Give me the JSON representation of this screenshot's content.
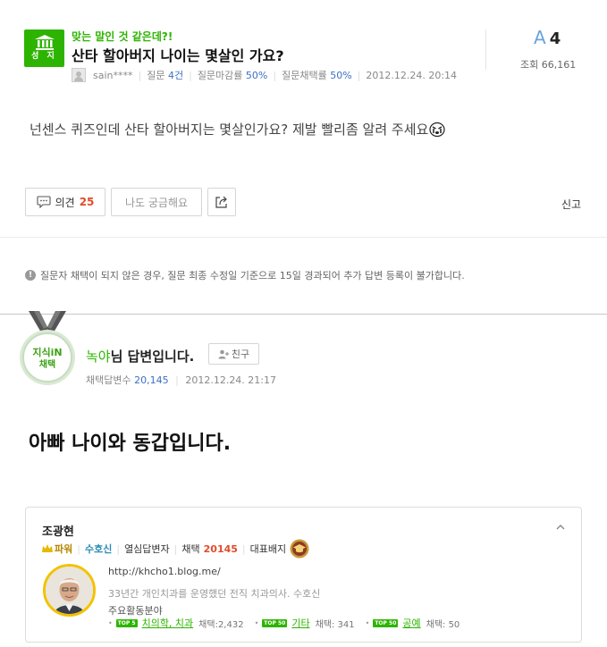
{
  "question": {
    "badge_label": "성 지",
    "subtitle": "맞는 말인 것 같은데?!",
    "title": "산타 할아버지 나이는 몇살인 가요?",
    "author": "sain****",
    "stats": {
      "question_label": "질문",
      "question_count": "4건",
      "close_label": "질문마감률",
      "close_rate": "50%",
      "adopt_label": "질문채택률",
      "adopt_rate": "50%",
      "date": "2012.12.24. 20:14"
    },
    "answer_mark": "A",
    "answer_count": "4",
    "views": "조회 66,161",
    "body": "넌센스 퀴즈인데 산타 할아버지는 몇살인가요? 제발 빨리좀 알려 주세요"
  },
  "actions": {
    "opinion_label": "의견",
    "opinion_count": "25",
    "curious_label": "나도 궁금해요",
    "report_label": "신고"
  },
  "notice": "질문자 채택이 되지 않은 경우, 질문 최종 수정일 기준으로 15일 경과되어 추가 답변 등록이 불가합니다.",
  "answer": {
    "medal_text": "지식iN",
    "medal_sub": "채택",
    "answerer_name": "녹야",
    "answerer_suffix": "님 답변입니다.",
    "friend_label": "친구",
    "adopt_label": "채택답변수",
    "adopt_count": "20,145",
    "date": "2012.12.24. 21:17",
    "body": "아빠 나이와 동갑입니다."
  },
  "profile": {
    "name": "조광현",
    "power": "파워",
    "guardian": "수호신",
    "level": "열심답변자",
    "adopt_label": "채택",
    "adopt_count": "20145",
    "rep_badge_label": "대표배지",
    "url": "http://khcho1.blog.me/",
    "desc": "33년간 개인치과를 운영했던 전직 치과의사. 수호신",
    "fields_title": "주요활동분야",
    "top_label": "TOP 5",
    "top50_label": "TOP 50",
    "fields": [
      {
        "name": "치의학, 치과",
        "count": "채택:2,432"
      },
      {
        "name": "기타",
        "count": "채택: 341"
      },
      {
        "name": "공예",
        "count": "채택: 50"
      }
    ]
  },
  "colors": {
    "green": "#2db400",
    "blue": "#3b70c5",
    "red": "#e04c2b"
  }
}
